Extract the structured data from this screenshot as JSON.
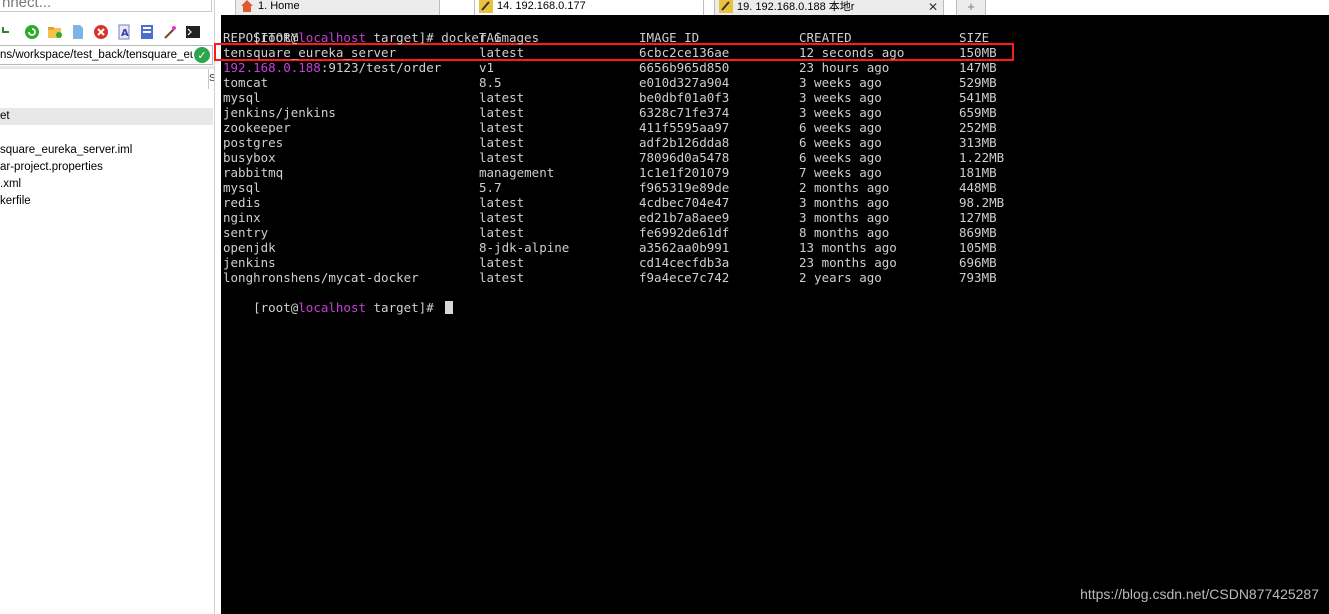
{
  "left_panel": {
    "connect_placeholder": "nnect...",
    "path": "ns/workspace/test_back/tensquare_eur",
    "column_letter": "S",
    "files": [
      "et",
      "square_eureka_server.iml",
      "ar-project.properties",
      ".xml",
      "kerfile"
    ]
  },
  "tabs": [
    {
      "label": "1. Home",
      "icon": "home-icon"
    },
    {
      "label": "14. 192.168.0.177",
      "icon": "terminal-tab-icon"
    },
    {
      "label": "19. 192.168.0.188 本地r",
      "icon": "terminal-tab-icon"
    }
  ],
  "terminal": {
    "prompt_user": "[root@",
    "prompt_host": "localhost",
    "prompt_dir": " target]# ",
    "command": "docker images",
    "headers": [
      "REPOSITORY",
      "TAG",
      "IMAGE ID",
      "CREATED",
      "SIZE"
    ],
    "rows": [
      {
        "repo": "tensquare_eureka_server",
        "tag": "latest",
        "id": "6cbc2ce136ae",
        "created": "12 seconds ago",
        "size": "150MB"
      },
      {
        "repo_ip": "192.168.0.188",
        "repo": ":9123/test/order",
        "tag": "v1",
        "id": "6656b965d850",
        "created": "23 hours ago",
        "size": "147MB"
      },
      {
        "repo": "tomcat",
        "tag": "8.5",
        "id": "e010d327a904",
        "created": "3 weeks ago",
        "size": "529MB"
      },
      {
        "repo": "mysql",
        "tag": "latest",
        "id": "be0dbf01a0f3",
        "created": "3 weeks ago",
        "size": "541MB"
      },
      {
        "repo": "jenkins/jenkins",
        "tag": "latest",
        "id": "6328c71fe374",
        "created": "3 weeks ago",
        "size": "659MB"
      },
      {
        "repo": "zookeeper",
        "tag": "latest",
        "id": "411f5595aa97",
        "created": "6 weeks ago",
        "size": "252MB"
      },
      {
        "repo": "postgres",
        "tag": "latest",
        "id": "adf2b126dda8",
        "created": "6 weeks ago",
        "size": "313MB"
      },
      {
        "repo": "busybox",
        "tag": "latest",
        "id": "78096d0a5478",
        "created": "6 weeks ago",
        "size": "1.22MB"
      },
      {
        "repo": "rabbitmq",
        "tag": "management",
        "id": "1c1e1f201079",
        "created": "7 weeks ago",
        "size": "181MB"
      },
      {
        "repo": "mysql",
        "tag": "5.7",
        "id": "f965319e89de",
        "created": "2 months ago",
        "size": "448MB"
      },
      {
        "repo": "redis",
        "tag": "latest",
        "id": "4cdbec704e47",
        "created": "3 months ago",
        "size": "98.2MB"
      },
      {
        "repo": "nginx",
        "tag": "latest",
        "id": "ed21b7a8aee9",
        "created": "3 months ago",
        "size": "127MB"
      },
      {
        "repo": "sentry",
        "tag": "latest",
        "id": "fe6992de61df",
        "created": "8 months ago",
        "size": "869MB"
      },
      {
        "repo": "openjdk",
        "tag": "8-jdk-alpine",
        "id": "a3562aa0b991",
        "created": "13 months ago",
        "size": "105MB"
      },
      {
        "repo": "jenkins",
        "tag": "latest",
        "id": "cd14cecfdb3a",
        "created": "23 months ago",
        "size": "696MB"
      },
      {
        "repo": "longhronshens/mycat-docker",
        "tag": "latest",
        "id": "f9a4ece7c742",
        "created": "2 years ago",
        "size": "793MB"
      }
    ]
  },
  "watermark": "https://blog.csdn.net/CSDN877425287",
  "colors": {
    "terminal_bg": "#000000",
    "terminal_fg": "#cfcfcf",
    "host_color": "#c73fd8",
    "highlight": "#ff1a1a"
  }
}
